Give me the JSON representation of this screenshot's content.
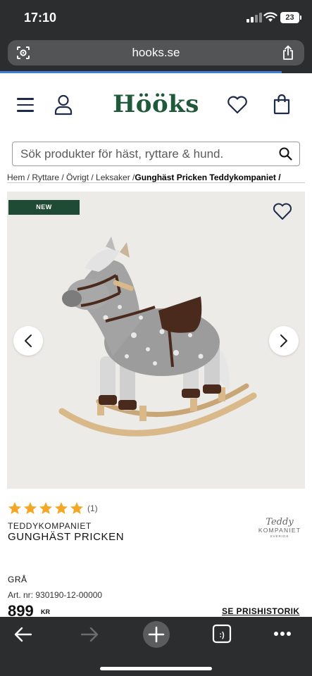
{
  "status": {
    "time": "17:10",
    "battery": "23"
  },
  "browser": {
    "url": "hooks.se"
  },
  "site": {
    "logo": "Hööks"
  },
  "search": {
    "placeholder": "Sök produkter för häst, ryttare & hund."
  },
  "breadcrumb": {
    "path": "Hem / Ryttare / Övrigt / Leksaker / ",
    "current": "Gunghäst Pricken Teddykompaniet /"
  },
  "product": {
    "badge": "NEW",
    "rating_stars": 5,
    "rating_count": "(1)",
    "brand": "TEDDYKOMPANIET",
    "name": "GUNGHÄST PRICKEN",
    "color": "GRÅ",
    "art_nr": "Art. nr: 930190-12-00000",
    "price": "899",
    "currency": "KR",
    "price_history_link": "SE PRISHISTORIK"
  },
  "brand_logo": {
    "script": "Teddy",
    "caps": "KOMPANIET",
    "tiny": "SVERIGE"
  },
  "colors": {
    "brand_green": "#1f5a3a",
    "badge_green": "#1f4a33",
    "star": "#f5a623",
    "chrome": "#2b2d2f"
  }
}
